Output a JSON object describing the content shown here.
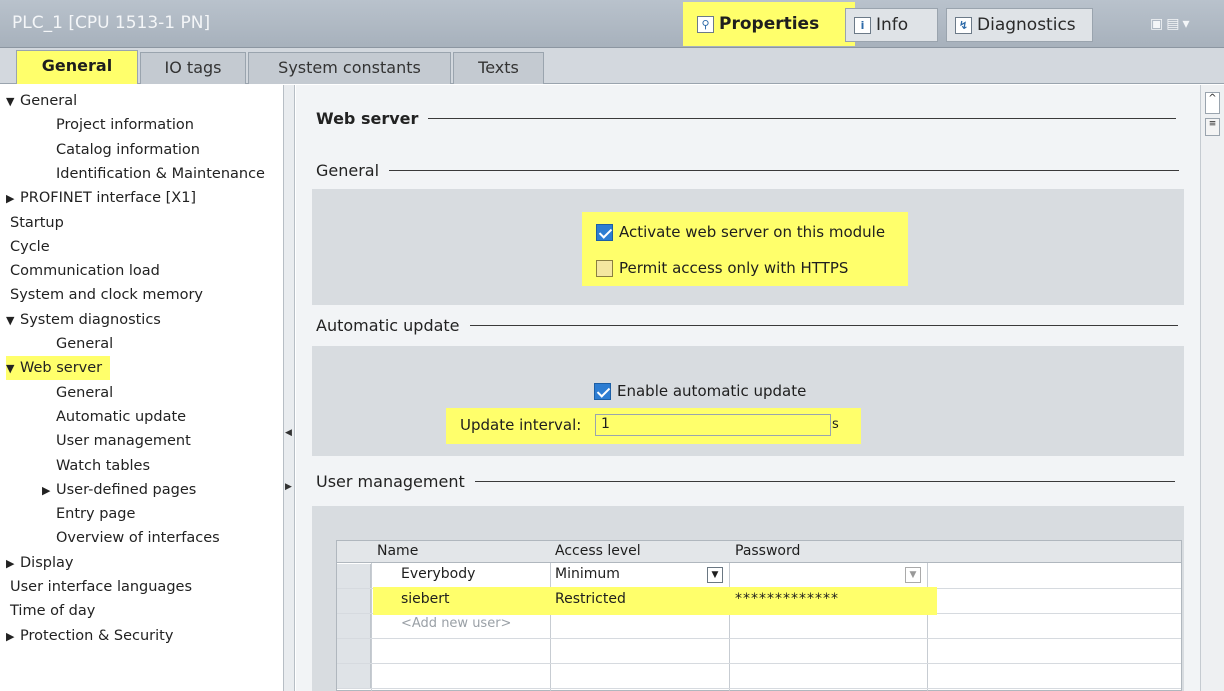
{
  "titlebar": {
    "title": "PLC_1 [CPU 1513-1 PN]",
    "tabs": {
      "properties": "Properties",
      "info": "Info",
      "diagnostics": "Diagnostics"
    }
  },
  "subtabs": [
    "General",
    "IO tags",
    "System constants",
    "Texts"
  ],
  "nav": [
    {
      "label": "General",
      "indent": 0,
      "tri": "down"
    },
    {
      "label": "Project information",
      "indent": 2
    },
    {
      "label": "Catalog information",
      "indent": 2
    },
    {
      "label": "Identification & Maintenance",
      "indent": 2
    },
    {
      "label": "PROFINET interface [X1]",
      "indent": 0,
      "tri": "right"
    },
    {
      "label": "Startup",
      "indent": 0
    },
    {
      "label": "Cycle",
      "indent": 0
    },
    {
      "label": "Communication load",
      "indent": 0
    },
    {
      "label": "System and clock memory",
      "indent": 0
    },
    {
      "label": "System diagnostics",
      "indent": 0,
      "tri": "down"
    },
    {
      "label": "General",
      "indent": 2
    },
    {
      "label": "Web server",
      "indent": 0,
      "tri": "down",
      "highlight": true
    },
    {
      "label": "General",
      "indent": 2
    },
    {
      "label": "Automatic update",
      "indent": 2
    },
    {
      "label": "User management",
      "indent": 2
    },
    {
      "label": "Watch tables",
      "indent": 2
    },
    {
      "label": "User-defined pages",
      "indent": 1,
      "tri": "right"
    },
    {
      "label": "Entry page",
      "indent": 2
    },
    {
      "label": "Overview of interfaces",
      "indent": 2
    },
    {
      "label": "Display",
      "indent": 0,
      "tri": "right"
    },
    {
      "label": "User interface languages",
      "indent": 0
    },
    {
      "label": "Time of day",
      "indent": 0
    },
    {
      "label": "Protection & Security",
      "indent": 0,
      "tri": "right"
    }
  ],
  "content": {
    "web_server_heading": "Web server",
    "general_heading": "General",
    "activate_label": "Activate web server on this module",
    "activate_checked": true,
    "https_label": "Permit access only with HTTPS",
    "https_checked": false,
    "auto_update_heading": "Automatic update",
    "enable_auto_label": "Enable automatic update",
    "enable_auto_checked": true,
    "update_interval_label": "Update interval:",
    "update_interval_value": "1",
    "update_interval_unit": "s",
    "user_mgmt_heading": "User management",
    "table": {
      "headers": [
        "Name",
        "Access level",
        "Password"
      ],
      "rows": [
        {
          "name": "Everybody",
          "access": "Minimum",
          "password": ""
        },
        {
          "name": "siebert",
          "access": "Restricted",
          "password": "*************"
        },
        {
          "name": "<Add new user>",
          "access": "",
          "password": ""
        }
      ]
    }
  },
  "colors": {
    "highlight": "#ffff6b",
    "checkbox_on": "#2d7dd2",
    "titlebar": "#b0b9c3"
  }
}
